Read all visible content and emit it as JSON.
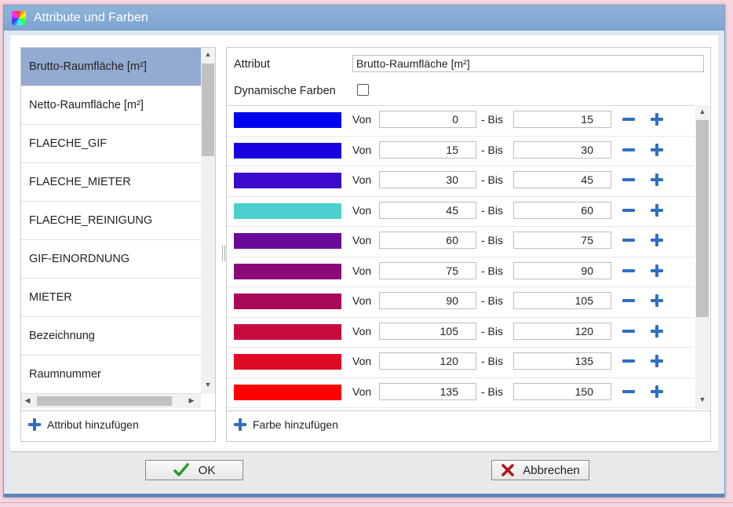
{
  "dialog": {
    "title": "Attribute und Farben"
  },
  "attributes": {
    "items": [
      {
        "label": "Brutto-Raumfläche [m²]",
        "selected": true
      },
      {
        "label": "Netto-Raumfläche [m²]"
      },
      {
        "label": "FLAECHE_GIF"
      },
      {
        "label": "FLAECHE_MIETER"
      },
      {
        "label": "FLAECHE_REINIGUNG"
      },
      {
        "label": "GIF-EINORDNUNG"
      },
      {
        "label": "MIETER"
      },
      {
        "label": "Bezeichnung"
      },
      {
        "label": "Raumnummer"
      }
    ],
    "add_label": "Attribut hinzufügen"
  },
  "detail": {
    "attribut_label": "Attribut",
    "attribut_value": "Brutto-Raumfläche [m²]",
    "dynamic_label": "Dynamische Farben",
    "dynamic_checked": false,
    "von_label": "Von",
    "bis_label": "- Bis",
    "add_color_label": "Farbe hinzufügen"
  },
  "color_rows": [
    {
      "color": "#0000ee",
      "from": "0",
      "to": "15"
    },
    {
      "color": "#1800e0",
      "from": "15",
      "to": "30"
    },
    {
      "color": "#3c0acd",
      "from": "30",
      "to": "45"
    },
    {
      "color": "#4ecfcf",
      "from": "45",
      "to": "60"
    },
    {
      "color": "#6a0a9a",
      "from": "60",
      "to": "75"
    },
    {
      "color": "#8c0a78",
      "from": "75",
      "to": "90"
    },
    {
      "color": "#a80a58",
      "from": "90",
      "to": "105"
    },
    {
      "color": "#c80a3c",
      "from": "105",
      "to": "120"
    },
    {
      "color": "#e00a24",
      "from": "120",
      "to": "135"
    },
    {
      "color": "#ff0000",
      "from": "135",
      "to": "150"
    }
  ],
  "buttons": {
    "ok_label": "OK",
    "cancel_label": "Abbrechen"
  }
}
